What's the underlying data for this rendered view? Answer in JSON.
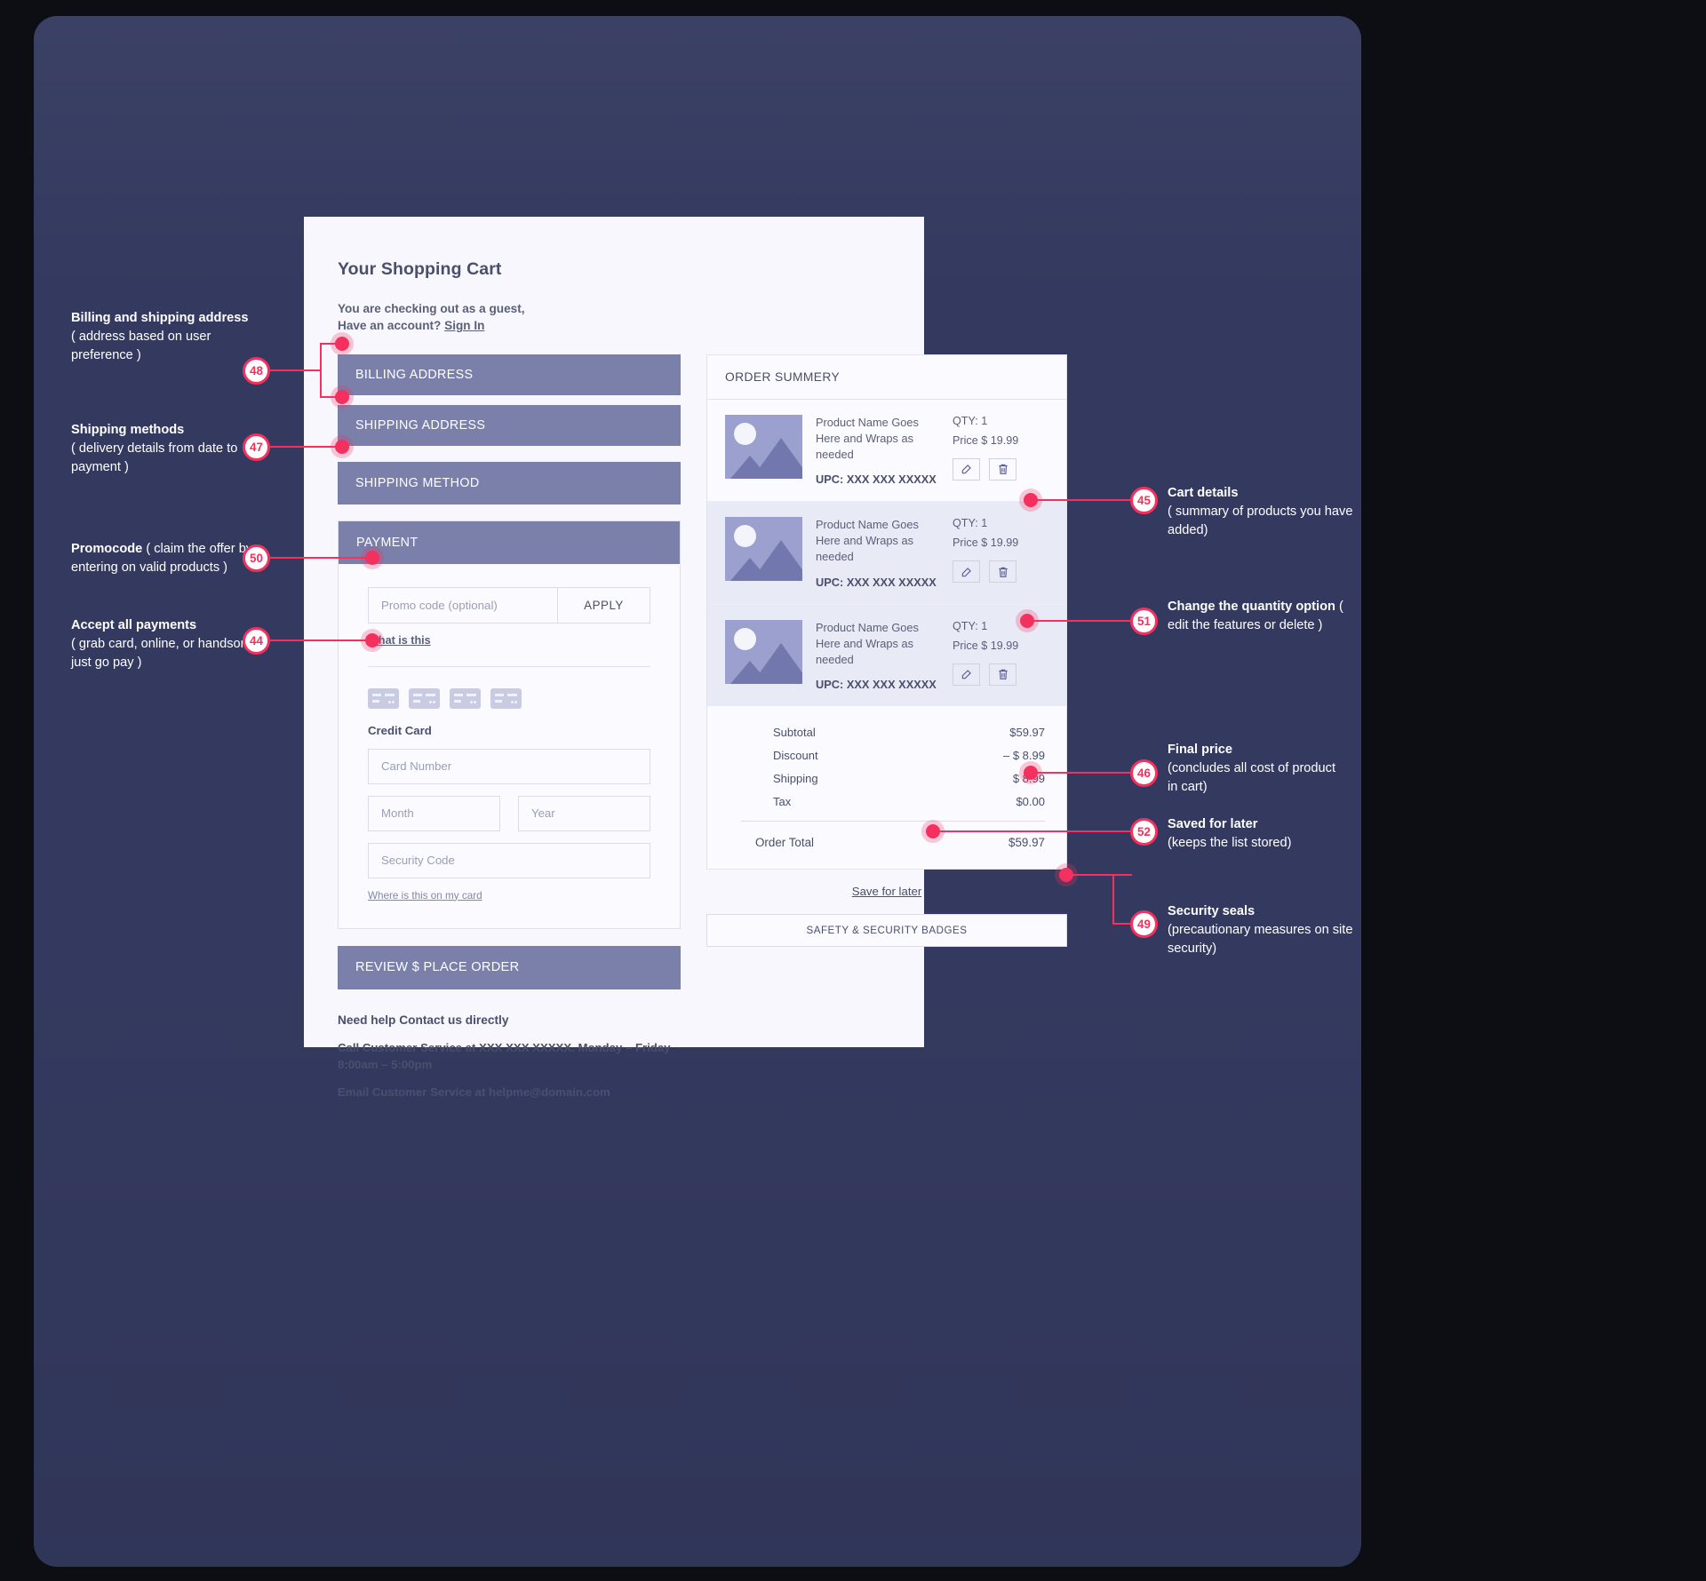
{
  "cart": {
    "title": "Your Shopping Cart",
    "guest_line1": "You are checking out as a guest,",
    "guest_line2_prefix": "Have an account? ",
    "sign_in": "Sign In",
    "sections": {
      "billing_address": "BILLING ADDRESS",
      "shipping_address": "SHIPPING ADDRESS",
      "shipping_method": "SHIPPING METHOD",
      "payment": "PAYMENT"
    },
    "promo": {
      "placeholder": "Promo code (optional)",
      "apply": "APPLY",
      "what_is_this": "What is this"
    },
    "credit_card": {
      "label": "Credit Card",
      "card_number_placeholder": "Card Number",
      "month_placeholder": "Month",
      "year_placeholder": "Year",
      "security_code_placeholder": "Security Code",
      "where_is_this": "Where is this on my card"
    },
    "review_button": "REVIEW $ PLACE ORDER",
    "help": {
      "heading": "Need help Contact us directly",
      "phone": "Call Customer Service at XXX XXX XXXXX. Monday – Friday 8:00am – 5:00pm",
      "email": "Email Customer Service at helpme@domain.com"
    }
  },
  "summary": {
    "heading": "ORDER SUMMERY",
    "products": [
      {
        "name": "Product Name Goes Here and Wraps as needed",
        "upc": "UPC: XXX XXX XXXXX",
        "qty": "QTY: 1",
        "price": "Price $ 19.99"
      },
      {
        "name": "Product Name Goes Here and Wraps as needed",
        "upc": "UPC: XXX XXX XXXXX",
        "qty": "QTY: 1",
        "price": "Price $ 19.99"
      },
      {
        "name": "Product Name Goes Here and Wraps as needed",
        "upc": "UPC: XXX XXX XXXXX",
        "qty": "QTY: 1",
        "price": "Price $ 19.99"
      }
    ],
    "totals": [
      {
        "label": "Subtotal",
        "value": "$59.97"
      },
      {
        "label": "Discount",
        "value": "– $ 8.99"
      },
      {
        "label": "Shipping",
        "value": "$ 8.99"
      },
      {
        "label": "Tax",
        "value": "$0.00"
      }
    ],
    "order_total_label": "Order Total",
    "order_total_value": "$59.97",
    "save_for_later": "Save for later",
    "security_badges": "SAFETY & SECURITY BADGES"
  },
  "annotations": {
    "a48": {
      "num": "48",
      "title": "Billing and shipping address",
      "body": "( address based on user preference )"
    },
    "a47": {
      "num": "47",
      "title": "Shipping methods",
      "body": "( delivery details from date to payment )"
    },
    "a50": {
      "num": "50",
      "title": "Promocode",
      "body": " ( claim the offer by entering on valid products  )"
    },
    "a44": {
      "num": "44",
      "title": "Accept all payments",
      "body": "( grab card, online, or handson just go pay )"
    },
    "a45": {
      "num": "45",
      "title": "Cart details",
      "body": "( summary of products you have added)"
    },
    "a51": {
      "num": "51",
      "title": "Change the quantity option",
      "body": " ( edit the features or delete )"
    },
    "a46": {
      "num": "46",
      "title": "Final price",
      "body": "(concludes all cost of product in cart)"
    },
    "a52": {
      "num": "52",
      "title": "Saved for later",
      "body": "(keeps the list stored)"
    },
    "a49": {
      "num": "49",
      "title": "Security seals",
      "body": "(precautionary measures on site security)"
    }
  },
  "colors": {
    "backdrop": "#343a5f",
    "accent": "#f4305f",
    "section_bar": "#7b80ab",
    "card_bg": "#f7f7fd"
  }
}
